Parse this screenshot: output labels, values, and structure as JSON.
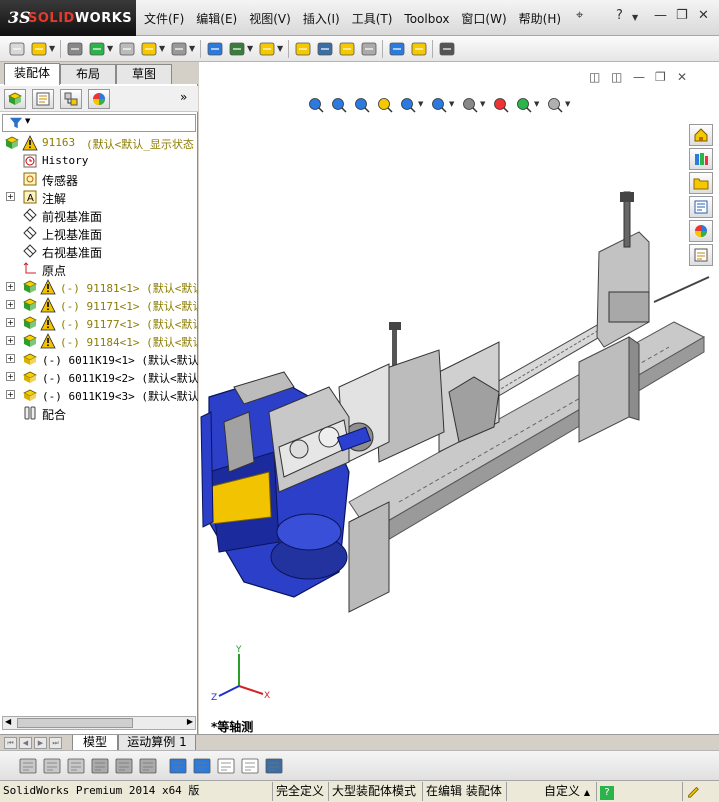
{
  "app": {
    "logo_ds": "3S",
    "logo_name_pre": "SOLID",
    "logo_name_post": "WORKS"
  },
  "menu": [
    "文件(F)",
    "编辑(E)",
    "视图(V)",
    "插入(I)",
    "工具(T)",
    "Toolbox",
    "窗口(W)",
    "帮助(H)"
  ],
  "window_controls": {
    "pin": "⌖",
    "help": "?",
    "minimize": "—",
    "restore": "❐",
    "close": "✕"
  },
  "panel_tabs": [
    "装配体",
    "布局",
    "草图"
  ],
  "tree": {
    "root": {
      "name": "91163",
      "config": "(默认<默认_显示状态"
    },
    "items": [
      {
        "label": "History",
        "icon": "history-icon"
      },
      {
        "label": "传感器",
        "icon": "sensor-icon"
      },
      {
        "label": "注解",
        "icon": "annotation-icon"
      },
      {
        "label": "前视基准面",
        "icon": "plane-icon"
      },
      {
        "label": "上视基准面",
        "icon": "plane-icon"
      },
      {
        "label": "右视基准面",
        "icon": "plane-icon"
      },
      {
        "label": "原点",
        "icon": "origin-icon"
      }
    ],
    "components": [
      {
        "label": "(-) 91181<1> (默认<默认",
        "type": "subassembly"
      },
      {
        "label": "(-) 91171<1> (默认<默认",
        "type": "subassembly"
      },
      {
        "label": "(-) 91177<1> (默认<默认",
        "type": "subassembly"
      },
      {
        "label": "(-) 91184<1> (默认<默认",
        "type": "subassembly"
      },
      {
        "label": "(-) 6011K19<1> (默认<默认",
        "type": "part"
      },
      {
        "label": "(-) 6011K19<2> (默认<默认",
        "type": "part"
      },
      {
        "label": "(-) 6011K19<3> (默认<默认",
        "type": "part"
      }
    ],
    "mates": "配合"
  },
  "viewport": {
    "view_name": "*等轴测",
    "triad_axes": [
      "X",
      "Y",
      "Z"
    ]
  },
  "bottom_tabs": [
    "模型",
    "运动算例 1"
  ],
  "status": {
    "product": "SolidWorks Premium 2014 x64 版",
    "definition": "完全定义",
    "mode": "大型装配体模式",
    "editing": "在编辑 装配体",
    "units": "自定义",
    "help": "?"
  },
  "colors": {
    "accent": "#3b6ea5",
    "warning": "#f2c300",
    "machine_blue": "#2c3fc8",
    "machine_grey": "#b9b9b9"
  }
}
